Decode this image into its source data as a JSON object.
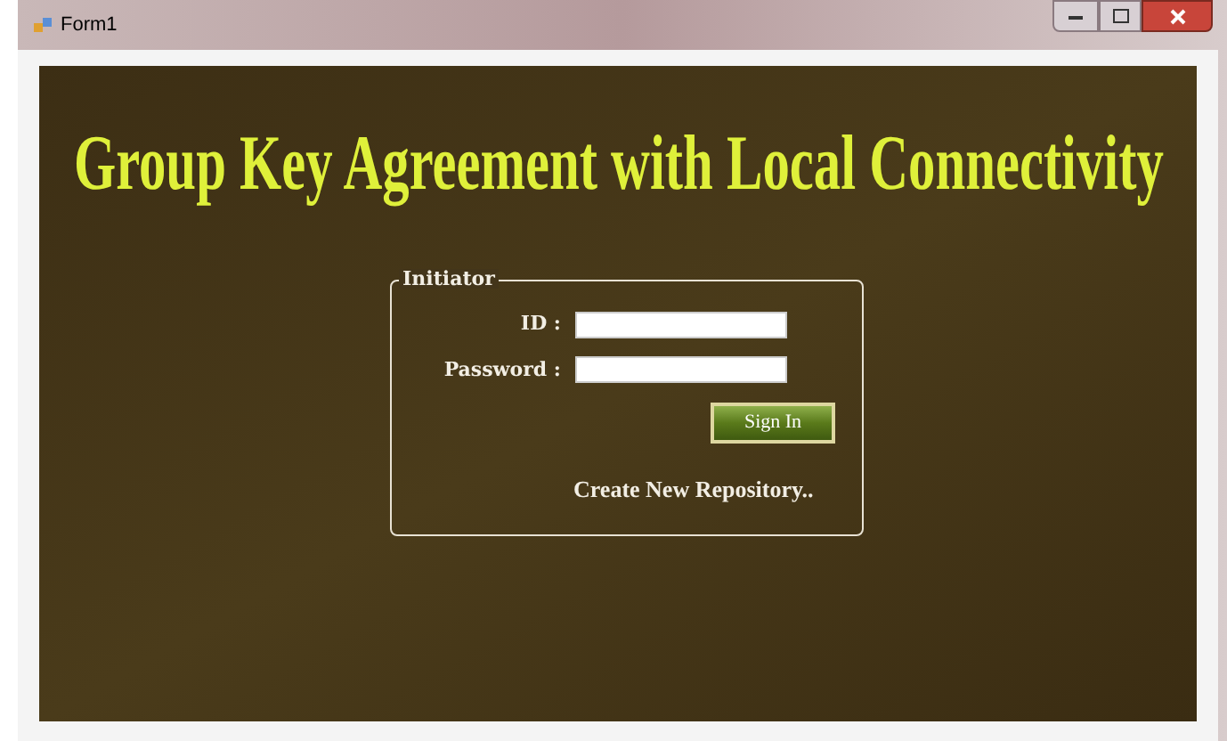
{
  "window": {
    "title": "Form1"
  },
  "heading": "Group Key Agreement with Local Connectivity",
  "group": {
    "title": "Initiator",
    "fields": [
      {
        "label": "ID :"
      },
      {
        "label": "Password :"
      }
    ],
    "button": "Sign In",
    "link": "Create New Repository.."
  }
}
